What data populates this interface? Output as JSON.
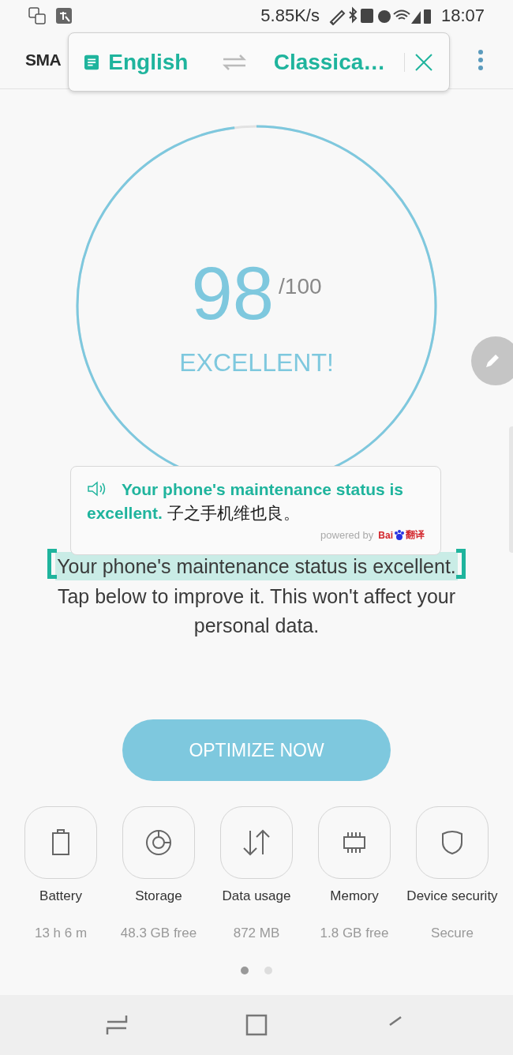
{
  "status_bar": {
    "speed": "5.85K/s",
    "time": "18:07"
  },
  "header": {
    "title": "SMA"
  },
  "translate_bar": {
    "source_language": "English",
    "target_language": "Classica…"
  },
  "score": {
    "level": 0.98,
    "value": "98",
    "max": "/100",
    "rating": "EXCELLENT!"
  },
  "translation_popup": {
    "source": "Your phone's maintenance status is excellent.",
    "translation": "子之手机维也良。",
    "powered_by": "powered by",
    "provider_prefix": "Bai",
    "provider_suffix": "翻译"
  },
  "message": {
    "selected": "Your phone's maintenance status is excellent.",
    "rest": "Tap below to improve it. This won't affect your personal data."
  },
  "optimize_button": "OPTIMIZE NOW",
  "tiles": [
    {
      "kind": "battery",
      "label": "Battery",
      "value": "13 h 6 m"
    },
    {
      "kind": "storage",
      "label": "Storage",
      "value": "48.3 GB free"
    },
    {
      "kind": "data",
      "label": "Data usage",
      "value": "872 MB"
    },
    {
      "kind": "memory",
      "label": "Memory",
      "value": "1.8 GB free"
    },
    {
      "kind": "security",
      "label": "Device security",
      "value": "Secure"
    }
  ],
  "pager": [
    {
      "selected": true
    },
    {
      "selected": false
    }
  ]
}
